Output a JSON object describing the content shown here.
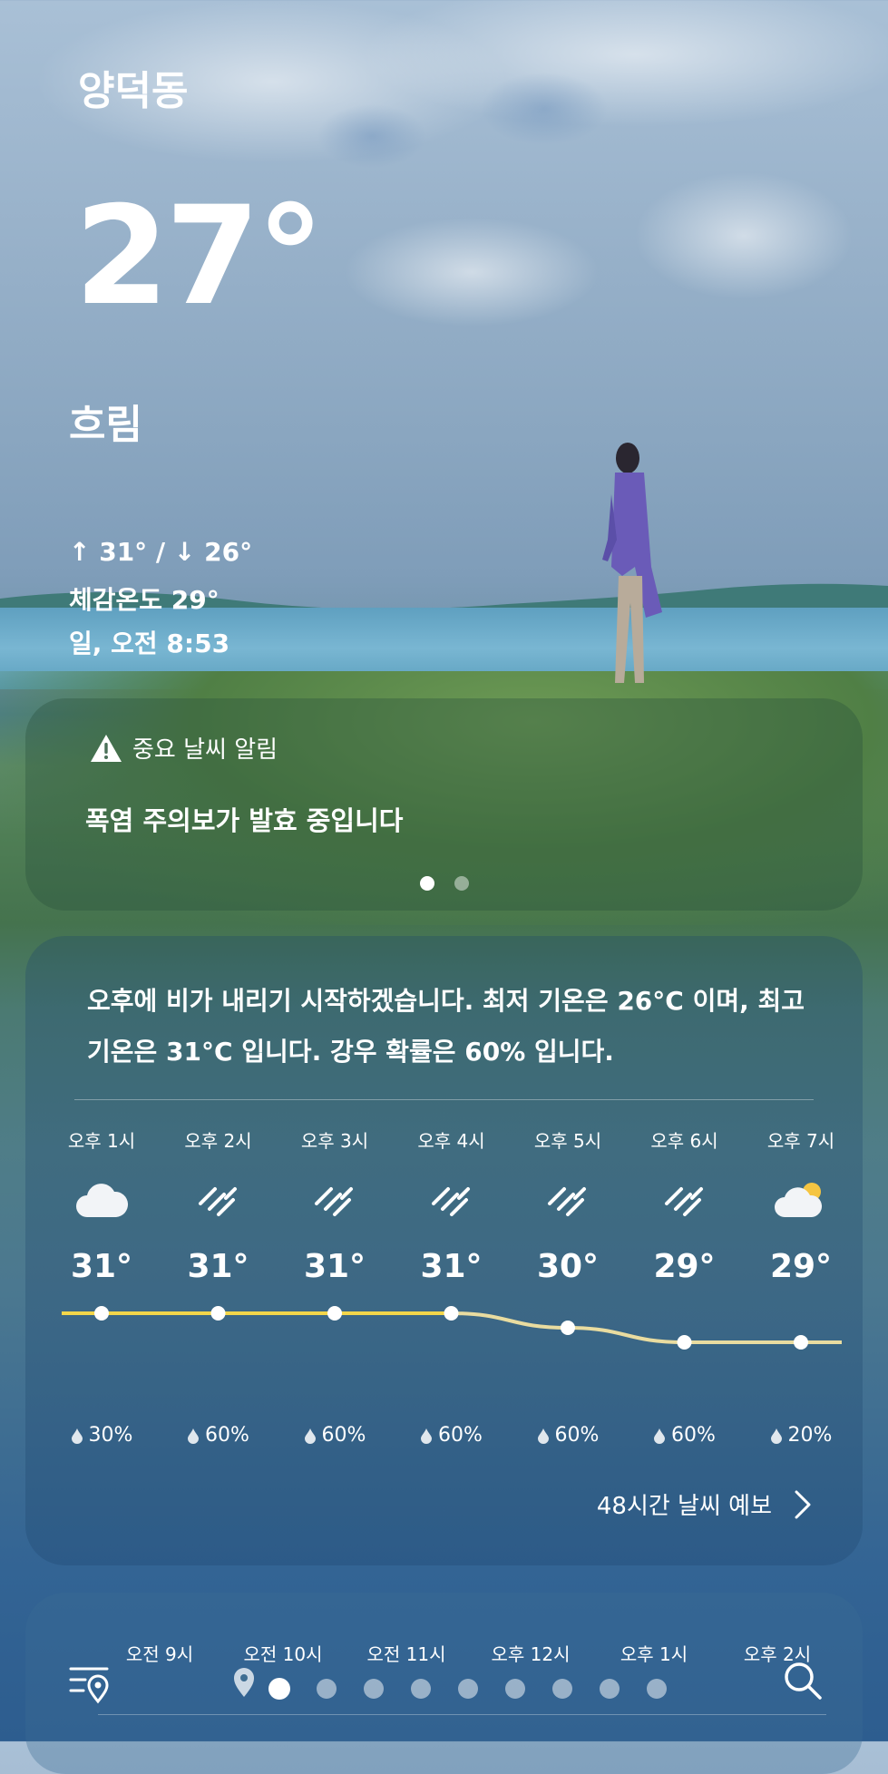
{
  "current": {
    "location": "양덕동",
    "temperature": "27°",
    "condition": "흐림",
    "high_low": "↑ 31° / ↓ 26°",
    "feels_like": "체감온도 29°",
    "updated": "일, 오전 8:53"
  },
  "alert": {
    "title": "중요 날씨 알림",
    "message": "폭염 주의보가 발효 중입니다",
    "page_count": 2,
    "active_page": 1
  },
  "forecast": {
    "summary": "오후에 비가 내리기 시작하겠습니다. 최저 기온은 26°C 이며, 최고 기온은 31°C 입니다. 강우 확률은 60% 입니다.",
    "hours": [
      {
        "time": "오후 1시",
        "icon": "cloudy-icon",
        "temp": "31°",
        "temp_value": 31,
        "precip": "30%"
      },
      {
        "time": "오후 2시",
        "icon": "rain-icon",
        "temp": "31°",
        "temp_value": 31,
        "precip": "60%"
      },
      {
        "time": "오후 3시",
        "icon": "rain-icon",
        "temp": "31°",
        "temp_value": 31,
        "precip": "60%"
      },
      {
        "time": "오후 4시",
        "icon": "rain-icon",
        "temp": "31°",
        "temp_value": 31,
        "precip": "60%"
      },
      {
        "time": "오후 5시",
        "icon": "rain-icon",
        "temp": "30°",
        "temp_value": 30,
        "precip": "60%"
      },
      {
        "time": "오후 6시",
        "icon": "rain-icon",
        "temp": "29°",
        "temp_value": 29,
        "precip": "60%"
      },
      {
        "time": "오후 7시",
        "icon": "partly-cloudy-icon",
        "temp": "29°",
        "temp_value": 29,
        "precip": "20%"
      }
    ],
    "more_label": "48시간 날씨 예보"
  },
  "timeline": {
    "labels": [
      "오전 9시",
      "오전 10시",
      "오전 11시",
      "오후 12시",
      "오후 1시",
      "오후 2시"
    ],
    "current_index": 0
  },
  "colors": {
    "temp_line_active": "#f3d64a",
    "temp_line_future": "#e9dca0"
  }
}
